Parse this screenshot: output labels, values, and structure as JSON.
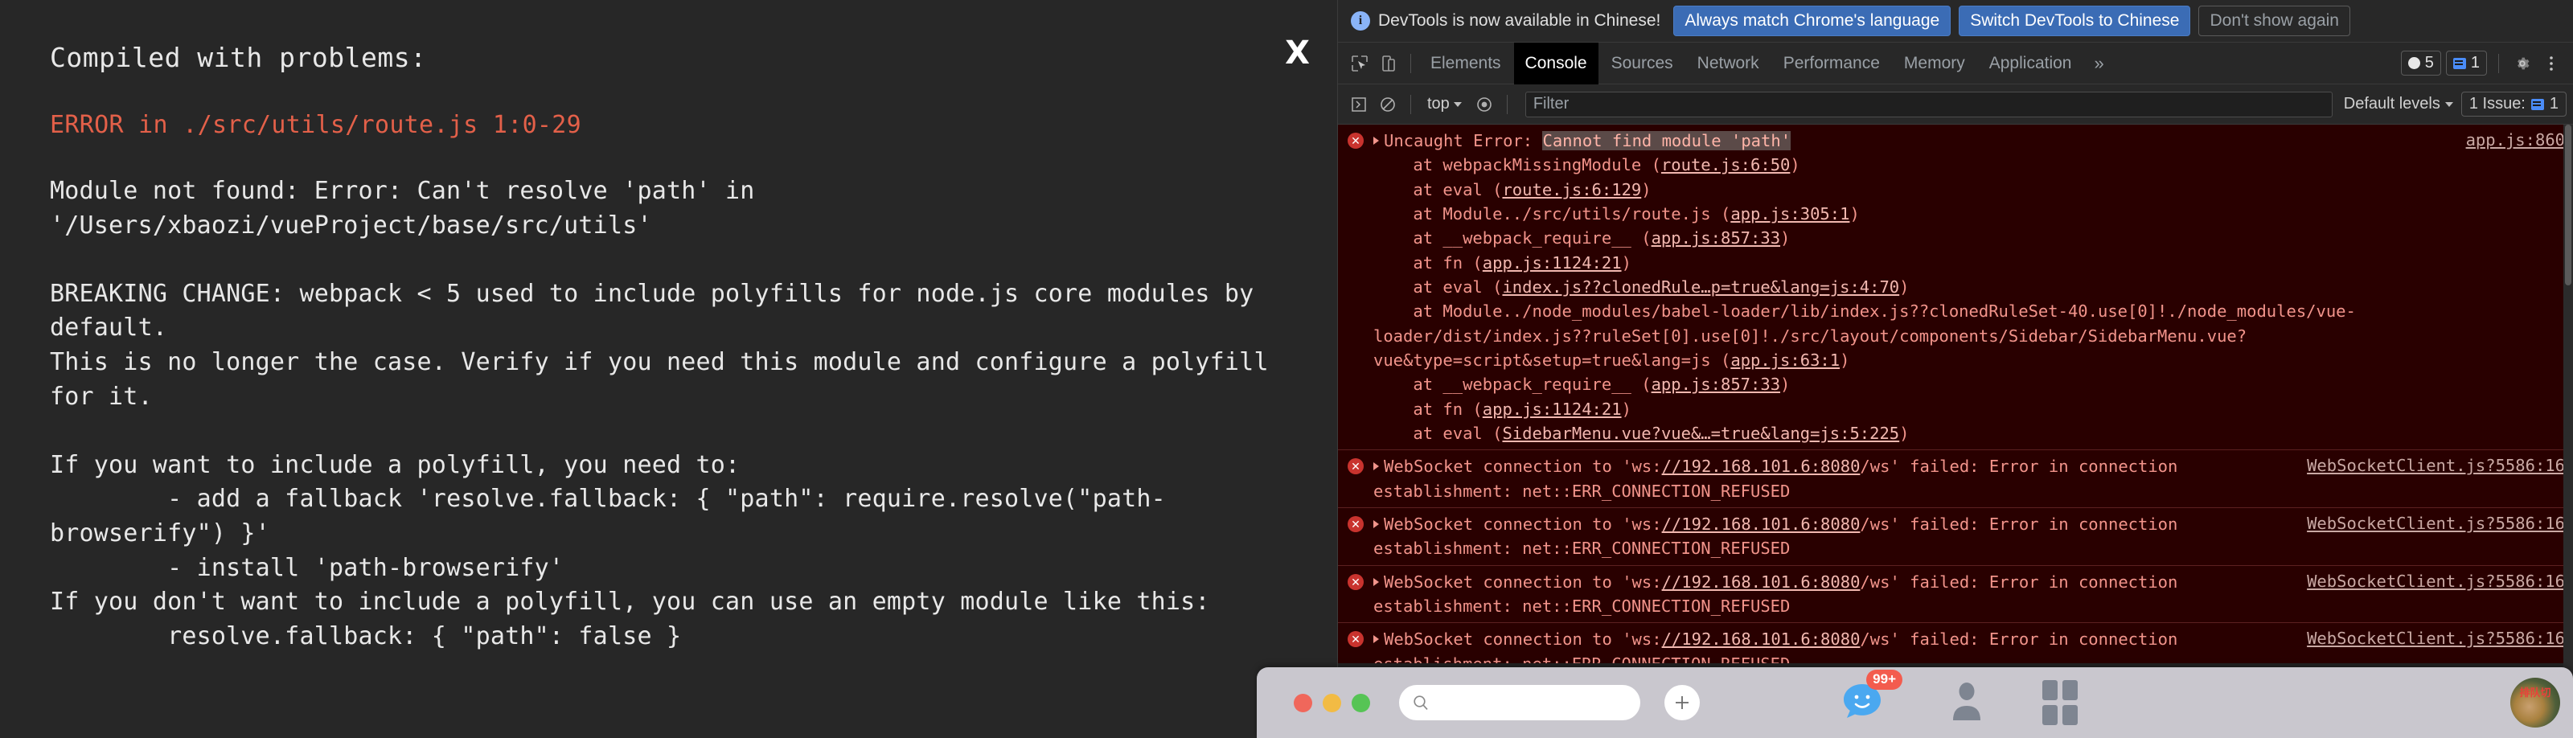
{
  "overlay": {
    "title": "Compiled with problems:",
    "close_label": "X",
    "error_heading": "ERROR in ./src/utils/route.js 1:0-29",
    "body": "Module not found: Error: Can't resolve 'path' in '/Users/xbaozi/vueProject/base/src/utils'\n\nBREAKING CHANGE: webpack < 5 used to include polyfills for node.js core modules by default.\nThis is no longer the case. Verify if you need this module and configure a polyfill for it.\n\nIf you want to include a polyfill, you need to:\n        - add a fallback 'resolve.fallback: { \"path\": require.resolve(\"path-browserify\") }'\n        - install 'path-browserify'\nIf you don't want to include a polyfill, you can use an empty module like this:\n        resolve.fallback: { \"path\": false }"
  },
  "devtools": {
    "banner": {
      "message": "DevTools is now available in Chinese!",
      "btn_always": "Always match Chrome's language",
      "btn_switch": "Switch DevTools to Chinese",
      "btn_dismiss": "Don't show again"
    },
    "tabs": [
      {
        "label": "Elements",
        "active": false
      },
      {
        "label": "Console",
        "active": true
      },
      {
        "label": "Sources",
        "active": false
      },
      {
        "label": "Network",
        "active": false
      },
      {
        "label": "Performance",
        "active": false
      },
      {
        "label": "Memory",
        "active": false
      },
      {
        "label": "Application",
        "active": false
      }
    ],
    "more_tabs": "»",
    "error_count": "5",
    "warning_count": "1",
    "filterbar": {
      "context": "top",
      "filter_placeholder": "Filter",
      "filter_value": "",
      "levels": "Default levels",
      "issues": "1 Issue:",
      "issues_count": "1"
    },
    "messages": [
      {
        "kind": "error",
        "source": "app.js:860",
        "lines": [
          {
            "t": "Uncaught Error: ",
            "s": "plain",
            "expand": true
          },
          {
            "t": "Cannot find module 'path'",
            "s": "hl"
          },
          {
            "t": "\n    at webpackMissingModule (",
            "s": "plain"
          },
          {
            "t": "route.js:6:50",
            "s": "link"
          },
          {
            "t": ")\n    at eval (",
            "s": "plain"
          },
          {
            "t": "route.js:6:129",
            "s": "link"
          },
          {
            "t": ")\n    at Module../src/utils/route.js (",
            "s": "plain"
          },
          {
            "t": "app.js:305:1",
            "s": "link"
          },
          {
            "t": ")\n    at __webpack_require__ (",
            "s": "plain"
          },
          {
            "t": "app.js:857:33",
            "s": "link"
          },
          {
            "t": ")\n    at fn (",
            "s": "plain"
          },
          {
            "t": "app.js:1124:21",
            "s": "link"
          },
          {
            "t": ")\n    at eval (",
            "s": "plain"
          },
          {
            "t": "index.js??clonedRule…p=true&lang=js:4:70",
            "s": "link"
          },
          {
            "t": ")\n    at Module../node_modules/babel-loader/lib/index.js??clonedRuleSet-40.use[0]!./node_modules/vue-loader/dist/index.js??ruleSet[0].use[0]!./src/layout/components/Sidebar/SidebarMenu.vue?vue&type=script&setup=true&lang=js (",
            "s": "plain"
          },
          {
            "t": "app.js:63:1",
            "s": "link"
          },
          {
            "t": ")\n    at __webpack_require__ (",
            "s": "plain"
          },
          {
            "t": "app.js:857:33",
            "s": "link"
          },
          {
            "t": ")\n    at fn (",
            "s": "plain"
          },
          {
            "t": "app.js:1124:21",
            "s": "link"
          },
          {
            "t": ")\n    at eval (",
            "s": "plain"
          },
          {
            "t": "SidebarMenu.vue?vue&…=true&lang=js:5:225",
            "s": "link"
          },
          {
            "t": ")",
            "s": "plain"
          }
        ]
      },
      {
        "kind": "error",
        "source": "WebSocketClient.js?5586:16",
        "lines": [
          {
            "t": "WebSocket connection to 'ws:",
            "s": "plain",
            "expand": true
          },
          {
            "t": "//192.168.101.6:8080",
            "s": "link"
          },
          {
            "t": "/ws' failed: Error in connection establishment: net::ERR_CONNECTION_REFUSED",
            "s": "plain"
          }
        ]
      },
      {
        "kind": "error",
        "source": "WebSocketClient.js?5586:16",
        "lines": [
          {
            "t": "WebSocket connection to 'ws:",
            "s": "plain",
            "expand": true
          },
          {
            "t": "//192.168.101.6:8080",
            "s": "link"
          },
          {
            "t": "/ws' failed: Error in connection establishment: net::ERR_CONNECTION_REFUSED",
            "s": "plain"
          }
        ]
      },
      {
        "kind": "error",
        "source": "WebSocketClient.js?5586:16",
        "lines": [
          {
            "t": "WebSocket connection to 'ws:",
            "s": "plain",
            "expand": true
          },
          {
            "t": "//192.168.101.6:8080",
            "s": "link"
          },
          {
            "t": "/ws' failed: Error in connection establishment: net::ERR_CONNECTION_REFUSED",
            "s": "plain"
          }
        ]
      },
      {
        "kind": "error",
        "source": "WebSocketClient.js?5586:16",
        "lines": [
          {
            "t": "WebSocket connection to 'ws:",
            "s": "plain",
            "expand": true
          },
          {
            "t": "//192.168.101.6:8080",
            "s": "link"
          },
          {
            "t": "/ws' failed: Error in connection establishment: net::ERR_CONNECTION_REFUSED",
            "s": "plain"
          }
        ]
      }
    ]
  },
  "wechat": {
    "search_placeholder": "",
    "unread_badge": "99+",
    "avatar_text": "排队切"
  },
  "colors": {
    "overlay_bg": "#272727",
    "error_red": "#e36049",
    "devtools_bg": "#242424",
    "console_error_bg": "#290000",
    "accent_blue": "#3b6cb5",
    "link_pink": "#f2b8b0"
  }
}
